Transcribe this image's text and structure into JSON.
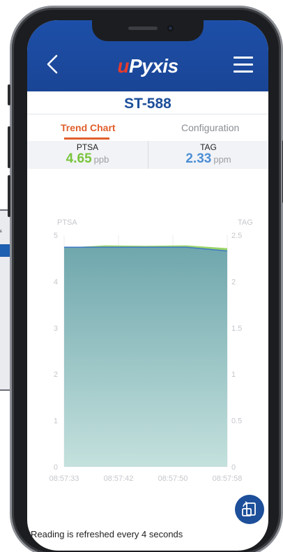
{
  "header": {
    "logo_prefix": "u",
    "logo_main": "Pyxis",
    "back_icon": "chevron-left-icon",
    "menu_icon": "hamburger-menu-icon"
  },
  "device": {
    "title": "ST-588"
  },
  "tabs": [
    {
      "label": "Trend Chart",
      "active": true
    },
    {
      "label": "Configuration",
      "active": false
    }
  ],
  "readings": {
    "left": {
      "label": "PTSA",
      "value": "4.65",
      "unit": "ppb"
    },
    "right": {
      "label": "TAG",
      "value": "2.33",
      "unit": "ppm"
    }
  },
  "chart_data": {
    "type": "area",
    "x": [
      "08:57:33",
      "08:57:42",
      "08:57:50",
      "08:57:58"
    ],
    "series": [
      {
        "name": "PTSA",
        "axis": "left",
        "values": [
          4.73,
          4.78,
          4.77,
          4.78,
          4.72
        ],
        "color": "#8fcf5a"
      },
      {
        "name": "TAG",
        "axis": "right",
        "values": [
          2.37,
          2.37,
          2.37,
          2.37,
          2.33
        ],
        "color": "#7fb4b8"
      }
    ],
    "left_axis": {
      "label": "PTSA",
      "range": [
        0,
        5
      ],
      "ticks": [
        "0",
        "1",
        "2",
        "3",
        "4",
        "5"
      ]
    },
    "right_axis": {
      "label": "TAG",
      "range": [
        0,
        2.5
      ],
      "ticks": [
        "0",
        "0.5",
        "1",
        "1.5",
        "2",
        "2.5"
      ]
    },
    "grid": true
  },
  "fab_icon": "rotate-screen-icon",
  "footer": {
    "note": "*Reading is refreshed every 4 seconds"
  },
  "colors": {
    "brand_blue": "#1d4fa8",
    "accent_orange": "#e05f2c",
    "ptsa_green": "#7ac43c",
    "tag_blue": "#4d8fd6"
  }
}
